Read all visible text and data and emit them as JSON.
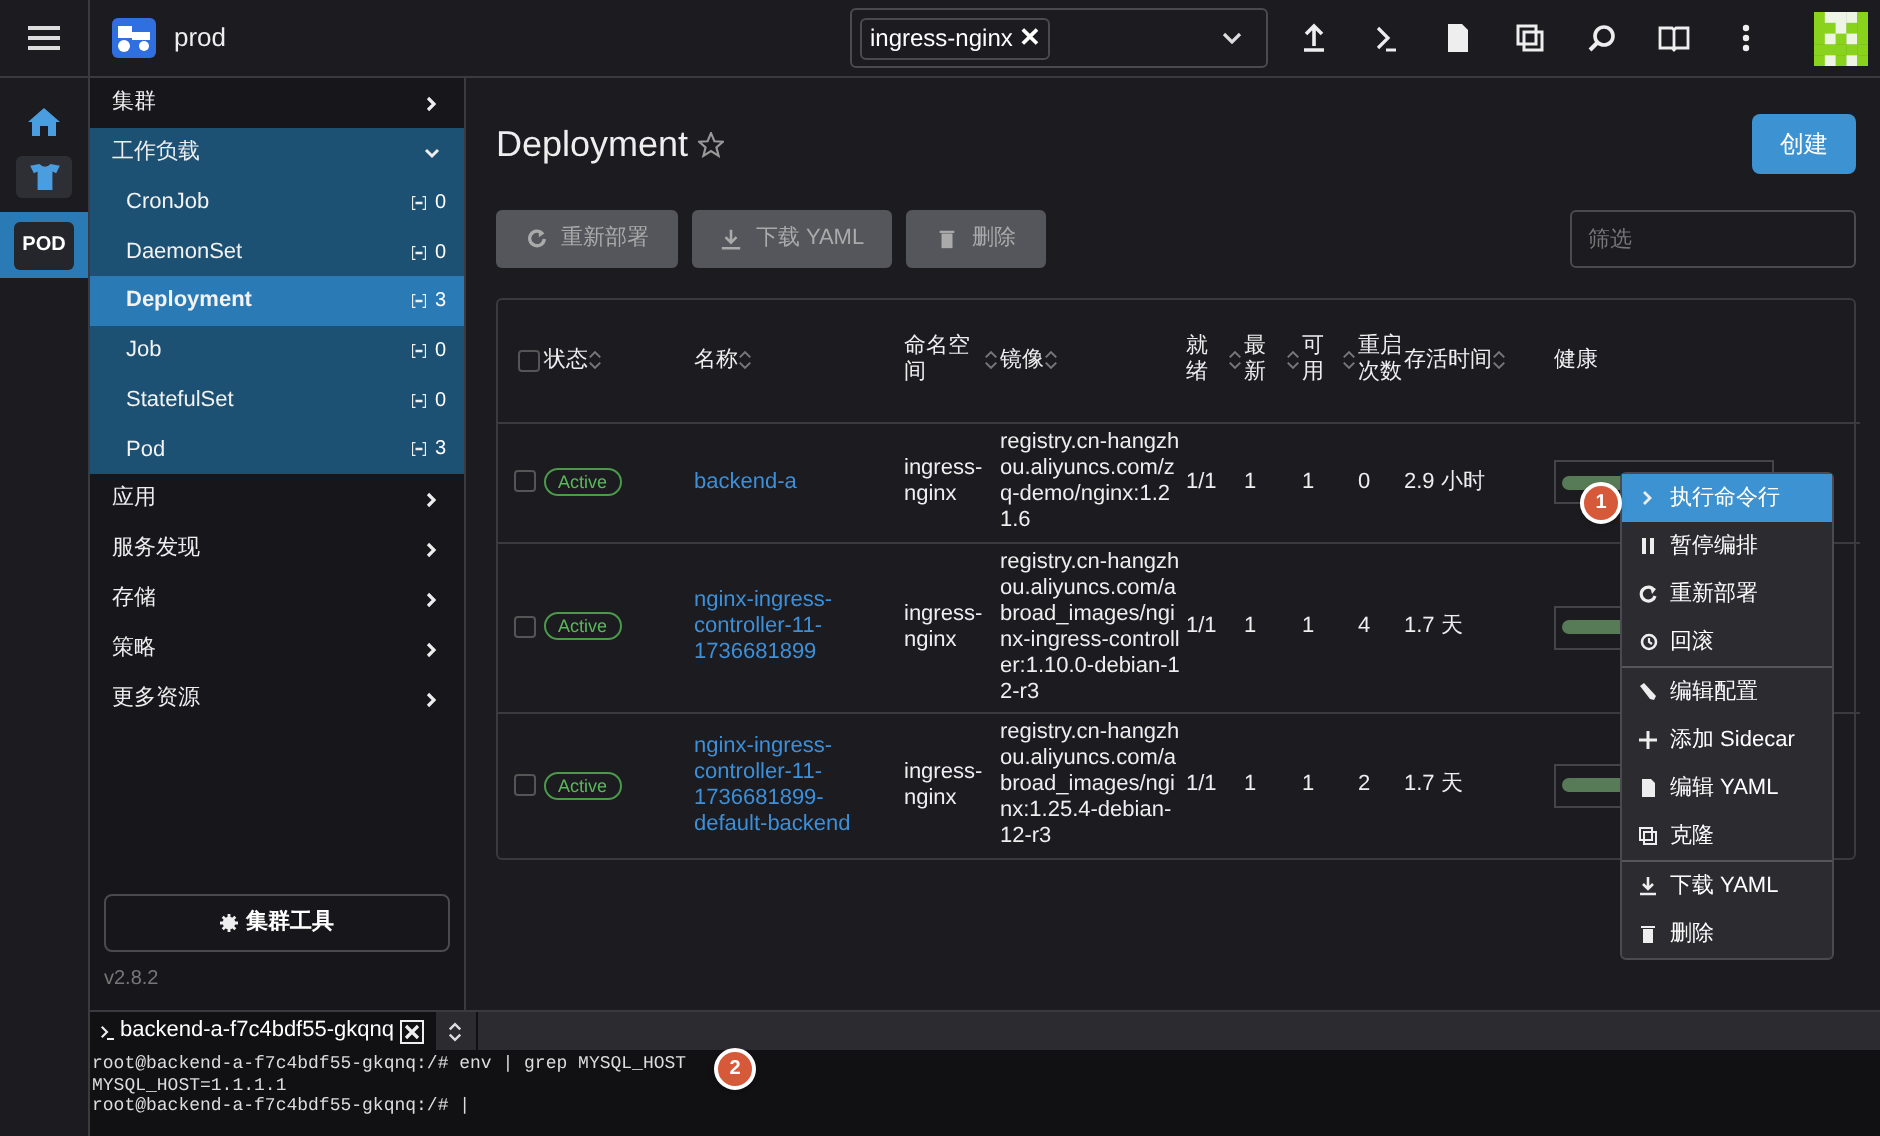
{
  "topbar": {
    "cluster": "prod",
    "namespace_tag": "ingress-nginx",
    "remove_tag": "✕"
  },
  "rail": {
    "items": [
      {
        "kind": "home"
      },
      {
        "kind": "workload"
      },
      {
        "kind": "pod",
        "label": "POD",
        "selected": true
      }
    ]
  },
  "nav": {
    "items": [
      {
        "label": "集群",
        "expanded": false
      },
      {
        "label": "工作负载",
        "expanded": true,
        "children": [
          {
            "label": "CronJob",
            "count": "0",
            "selected": false
          },
          {
            "label": "DaemonSet",
            "count": "0",
            "selected": false
          },
          {
            "label": "Deployment",
            "count": "3",
            "selected": true
          },
          {
            "label": "Job",
            "count": "0",
            "selected": false
          },
          {
            "label": "StatefulSet",
            "count": "0",
            "selected": false
          },
          {
            "label": "Pod",
            "count": "3",
            "selected": false
          }
        ]
      },
      {
        "label": "应用",
        "expanded": false
      },
      {
        "label": "服务发现",
        "expanded": false
      },
      {
        "label": "存储",
        "expanded": false
      },
      {
        "label": "策略",
        "expanded": false
      },
      {
        "label": "更多资源",
        "expanded": false
      }
    ],
    "tools_button": "集群工具",
    "version": "v2.8.2"
  },
  "page": {
    "title": "Deployment",
    "favorite": false,
    "create_button": "创建",
    "actions": [
      {
        "kind": "redeploy",
        "label": "重新部署",
        "disabled": true
      },
      {
        "kind": "download",
        "label": "下载 YAML",
        "disabled": true
      },
      {
        "kind": "delete",
        "label": "删除",
        "disabled": true
      }
    ],
    "filter": {
      "placeholder": "筛选"
    }
  },
  "table": {
    "select_all": false,
    "columns": [
      {
        "label": "状态",
        "sortable": true
      },
      {
        "label": "名称",
        "sortable": true
      },
      {
        "label": "命名空间",
        "sortable": true
      },
      {
        "label": "镜像",
        "sortable": true
      },
      {
        "label": "就绪",
        "sortable": true
      },
      {
        "label": "最新",
        "sortable": true
      },
      {
        "label": "可用",
        "sortable": true
      },
      {
        "label": "重启次数",
        "sortable": false
      },
      {
        "label": "存活时间",
        "sortable": true
      },
      {
        "label": "健康",
        "sortable": false
      }
    ],
    "rows": [
      {
        "checked": false,
        "status": "Active",
        "name": "backend-a",
        "namespace": "ingress-nginx",
        "image": "registry.cn-hangzhou.aliyuncs.com/zq-demo/nginx:1.21.6",
        "ready": "1/1",
        "up_to_date": "1",
        "available": "1",
        "restarts": "0",
        "age": "2.9 小时",
        "health": {
          "level": 1
        }
      },
      {
        "checked": false,
        "status": "Active",
        "name": "nginx-ingress-controller-11-1736681899",
        "namespace": "ingress-nginx",
        "image": "registry.cn-hangzhou.aliyuncs.com/abroad_images/nginx-ingress-controller:1.10.0-debian-12-r3",
        "ready": "1/1",
        "up_to_date": "1",
        "available": "1",
        "restarts": "4",
        "age": "1.7 天",
        "health": {
          "level": 1
        }
      },
      {
        "checked": false,
        "status": "Active",
        "name": "nginx-ingress-controller-11-1736681899-default-backend",
        "namespace": "ingress-nginx",
        "image": "registry.cn-hangzhou.aliyuncs.com/abroad_images/nginx:1.25.4-debian-12-r3",
        "ready": "1/1",
        "up_to_date": "1",
        "available": "1",
        "restarts": "2",
        "age": "1.7 天",
        "health": {
          "level": 1
        }
      }
    ]
  },
  "context_menu": {
    "items": [
      {
        "label": "执行命令行",
        "selected": true
      },
      {
        "label": "暂停编排",
        "selected": false
      },
      {
        "label": "重新部署",
        "selected": false
      },
      {
        "label": "回滚",
        "selected": false
      },
      {
        "label": "编辑配置",
        "selected": false,
        "divider_before": true
      },
      {
        "label": "添加 Sidecar",
        "selected": false
      },
      {
        "label": "编辑 YAML",
        "selected": false
      },
      {
        "label": "克隆",
        "selected": false
      },
      {
        "label": "下载 YAML",
        "selected": false,
        "divider_before": true
      },
      {
        "label": "删除",
        "selected": false
      }
    ]
  },
  "annotations": [
    "1",
    "2"
  ],
  "terminal": {
    "tab": "backend-a-f7c4bdf55-gkqnq",
    "lines": [
      "root@backend-a-f7c4bdf55-gkqnq:/# env | grep MYSQL_HOST",
      "MYSQL_HOST=1.1.1.1",
      "root@backend-a-f7c4bdf55-gkqnq:/# |"
    ]
  }
}
